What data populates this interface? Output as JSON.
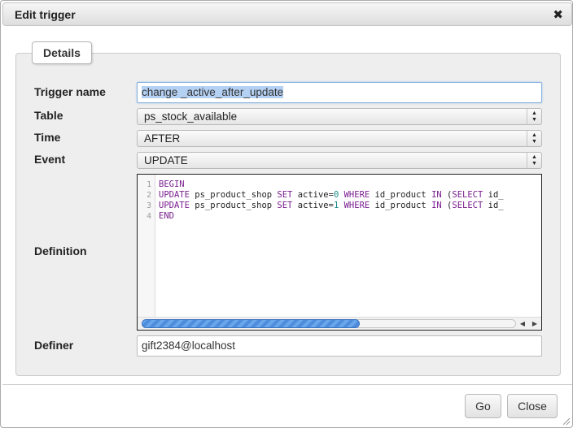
{
  "dialog": {
    "title": "Edit trigger",
    "close_glyph": "✖"
  },
  "details_tab": "Details",
  "form": {
    "trigger_name_label": "Trigger name",
    "trigger_name_value": "change _active_after_update",
    "table_label": "Table",
    "table_value": "ps_stock_available",
    "time_label": "Time",
    "time_value": "AFTER",
    "event_label": "Event",
    "event_value": "UPDATE",
    "definition_label": "Definition",
    "definer_label": "Definer",
    "definer_value": "gift2384@localhost"
  },
  "editor": {
    "line_numbers": [
      "1",
      "2",
      "3",
      "4"
    ],
    "line1_kw": "BEGIN",
    "line2": {
      "kw_update": "UPDATE",
      "t1": " ps_product_shop ",
      "kw_set": "SET",
      "t2": " active=",
      "num": "0",
      "t3": " ",
      "kw_where": "WHERE",
      "t4": " id_product ",
      "kw_in": "IN",
      "t5": " (",
      "kw_select": "SELECT",
      "t6": " id_"
    },
    "line3": {
      "kw_update": "UPDATE",
      "t1": " ps_product_shop ",
      "kw_set": "SET",
      "t2": " active=",
      "num": "1",
      "t3": " ",
      "kw_where": "WHERE",
      "t4": " id_product ",
      "kw_in": "IN",
      "t5": " (",
      "kw_select": "SELECT",
      "t6": " id_"
    },
    "line4_kw": "END",
    "scroll_left_glyph": "◀",
    "scroll_right_glyph": "▶"
  },
  "footer": {
    "go_label": "Go",
    "close_label": "Close"
  },
  "icons": {
    "select_arrows": "▲▼",
    "close_icon": "close-icon",
    "resize_icon": "resize-grip-icon"
  }
}
